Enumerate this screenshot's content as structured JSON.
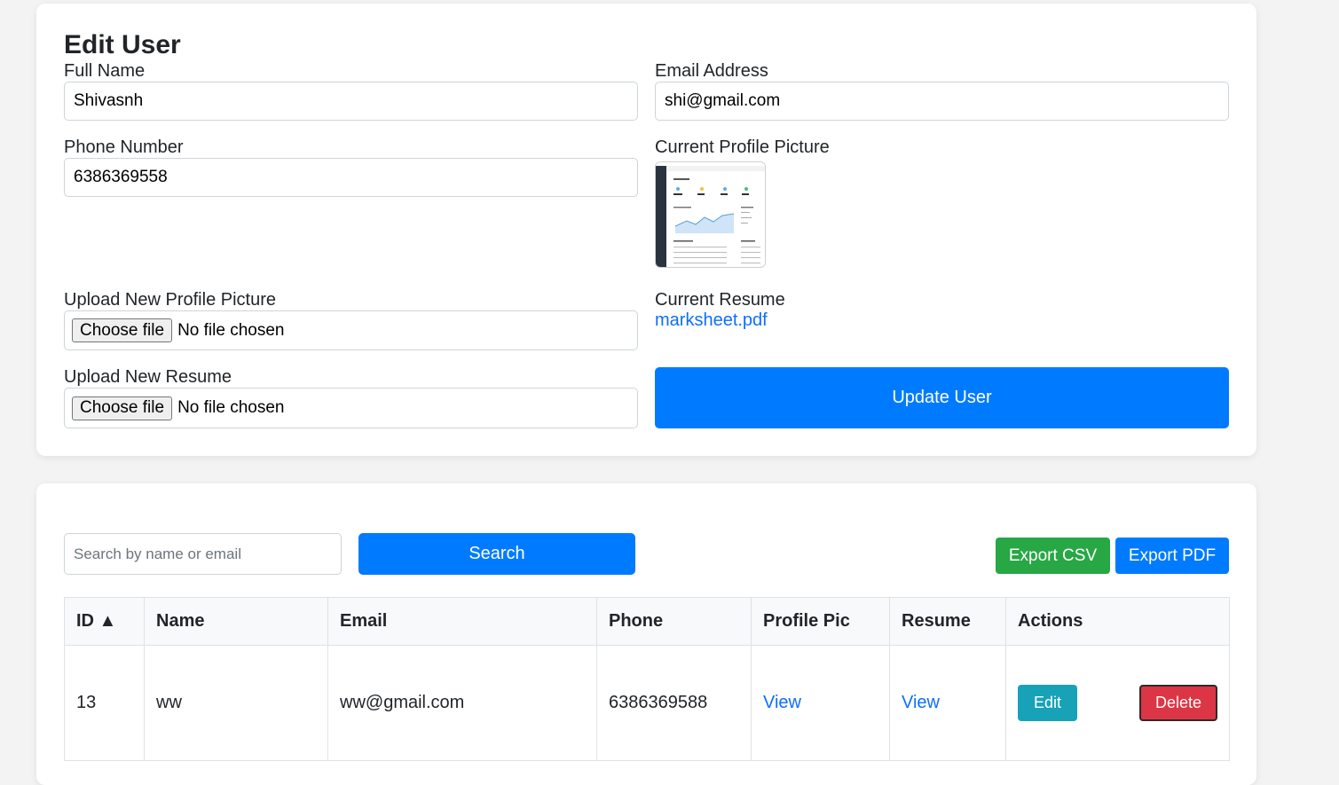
{
  "edit_form": {
    "title": "Edit User",
    "full_name_label": "Full Name",
    "full_name_value": "Shivasnh",
    "email_label": "Email Address",
    "email_value": "shi@gmail.com",
    "phone_label": "Phone Number",
    "phone_value": "6386369558",
    "current_pic_label": "Current Profile Picture",
    "upload_pic_label": "Upload New Profile Picture",
    "upload_resume_label": "Upload New Resume",
    "choose_file_label": "Choose file",
    "no_file_text": "No file chosen",
    "current_resume_label": "Current Resume",
    "current_resume_link": "marksheet.pdf",
    "update_button": "Update User"
  },
  "user_list": {
    "search_placeholder": "Search by name or email",
    "search_button": "Search",
    "export_csv": "Export CSV",
    "export_pdf": "Export PDF",
    "columns": [
      "ID ▲",
      "Name",
      "Email",
      "Phone",
      "Profile Pic",
      "Resume",
      "Actions"
    ],
    "rows": [
      {
        "id": "13",
        "name": "ww",
        "email": "ww@gmail.com",
        "phone": "6386369588",
        "profile_pic_link": "View",
        "resume_link": "View",
        "edit_label": "Edit",
        "delete_label": "Delete"
      }
    ]
  },
  "colors": {
    "primary": "#007bff",
    "success": "#28a745",
    "info": "#17a2b8",
    "danger": "#dc3545",
    "background": "#f3f3f4"
  }
}
